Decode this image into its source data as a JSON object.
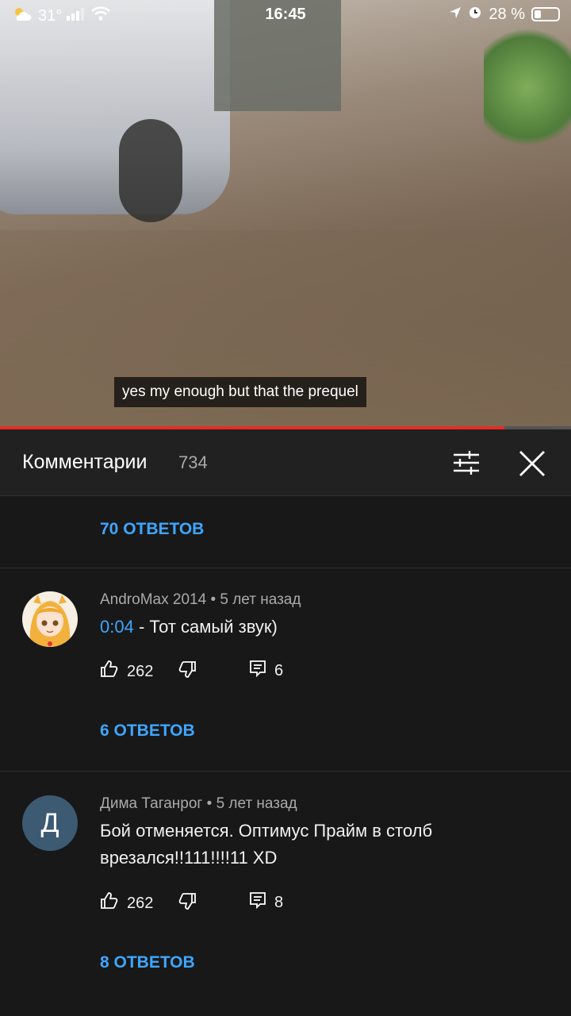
{
  "status_bar": {
    "temperature": "31°",
    "time": "16:45",
    "battery": "28 %",
    "battery_level": 0.28
  },
  "video": {
    "subtitle": "yes my enough but that the prequel",
    "progress": 0.884
  },
  "comments_header": {
    "title": "Комментарии",
    "count": "734"
  },
  "comments": [
    {
      "replies_label": "70 ОТВЕТОВ"
    },
    {
      "author": "AndroMax 2014",
      "age": "5 лет назад",
      "timestamp": "0:04",
      "text": " - Тот самый звук)",
      "likes": "262",
      "reply_count": "6",
      "replies_label": "6 ОТВЕТОВ"
    },
    {
      "author": "Дима Таганрог",
      "age": "5 лет назад",
      "avatar_letter": "Д",
      "text": "Бой отменяется. Оптимус Прайм в столб врезался!!111!!!!11 XD",
      "likes": "262",
      "reply_count": "8",
      "replies_label": "8 ОТВЕТОВ"
    }
  ],
  "colors": {
    "accent": "#3ea6ff",
    "progress": "#e52d27",
    "background": "#181818"
  }
}
